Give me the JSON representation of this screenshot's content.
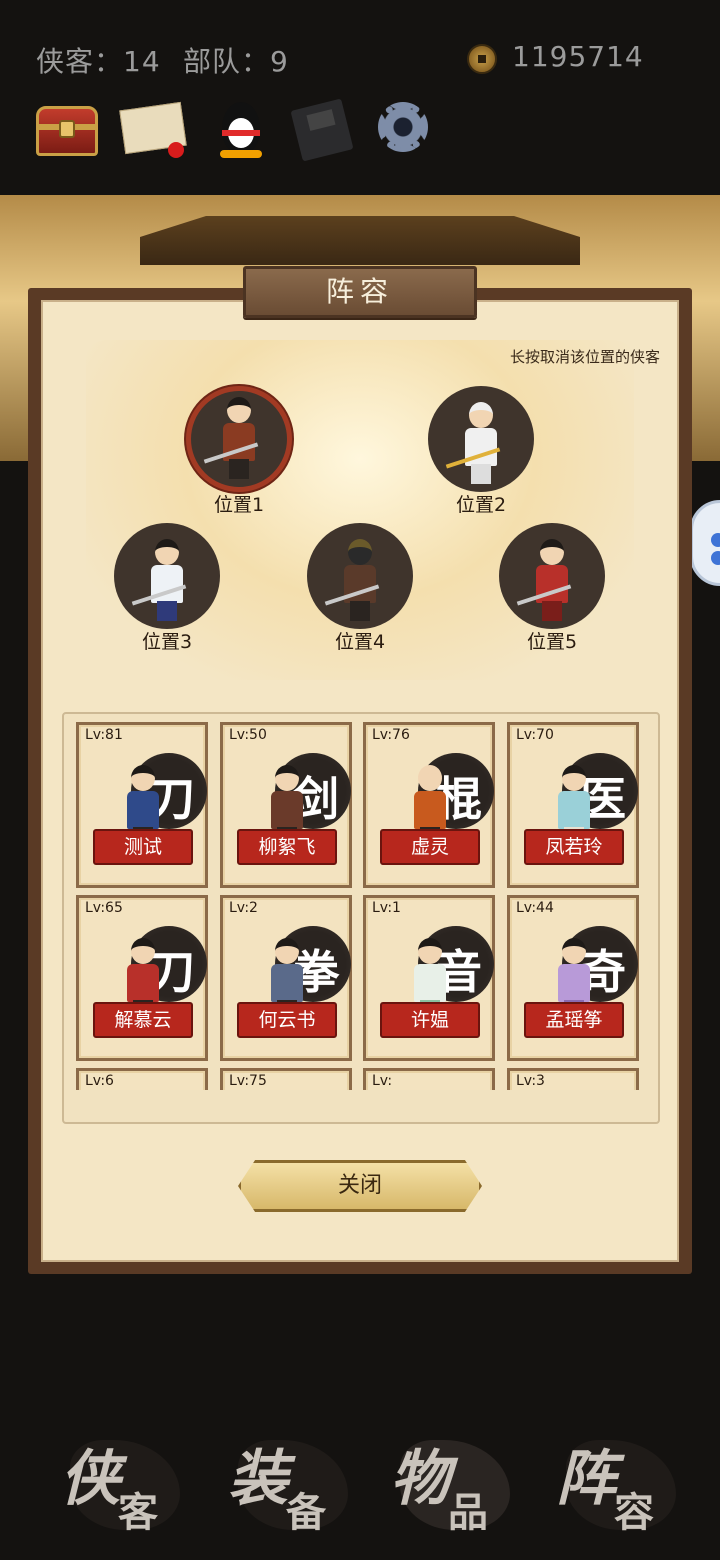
{
  "header": {
    "heroes_label": "侠客：14",
    "troops_label": "部队：9",
    "money": "1195714"
  },
  "toolbar": {
    "icons": [
      "treasure-chest-icon",
      "mail-icon",
      "qq-penguin-icon",
      "save-disk-icon",
      "gear-icon"
    ]
  },
  "dialog": {
    "title": "阵容",
    "hint": "长按取消该位置的侠客",
    "slots": [
      {
        "label": "位置1"
      },
      {
        "label": "位置2"
      },
      {
        "label": "位置3"
      },
      {
        "label": "位置4"
      },
      {
        "label": "位置5"
      }
    ],
    "roster": [
      {
        "lv": "Lv:81",
        "type": "刀",
        "name": "测试"
      },
      {
        "lv": "Lv:50",
        "type": "剑",
        "name": "柳絮飞"
      },
      {
        "lv": "Lv:76",
        "type": "棍",
        "name": "虚灵"
      },
      {
        "lv": "Lv:70",
        "type": "医",
        "name": "凤若玲"
      },
      {
        "lv": "Lv:65",
        "type": "刀",
        "name": "解慕云"
      },
      {
        "lv": "Lv:2",
        "type": "拳",
        "name": "何云书"
      },
      {
        "lv": "Lv:1",
        "type": "音",
        "name": "许媪"
      },
      {
        "lv": "Lv:44",
        "type": "奇",
        "name": "孟瑶筝"
      },
      {
        "lv": "Lv:6",
        "type": "",
        "name": ""
      },
      {
        "lv": "Lv:75",
        "type": "",
        "name": ""
      },
      {
        "lv": "Lv:",
        "type": "",
        "name": ""
      },
      {
        "lv": "Lv:3",
        "type": "",
        "name": ""
      }
    ],
    "close_label": "关闭"
  },
  "bottom_nav": [
    {
      "big": "侠",
      "small": "客"
    },
    {
      "big": "装",
      "small": "备"
    },
    {
      "big": "物",
      "small": "品"
    },
    {
      "big": "阵",
      "small": "容"
    }
  ],
  "colors": {
    "panel_frame": "#5a3a25",
    "panel_bg": "#f4e6c5",
    "name_plate": "#b7271d",
    "selected_ring": "#a23a23"
  }
}
